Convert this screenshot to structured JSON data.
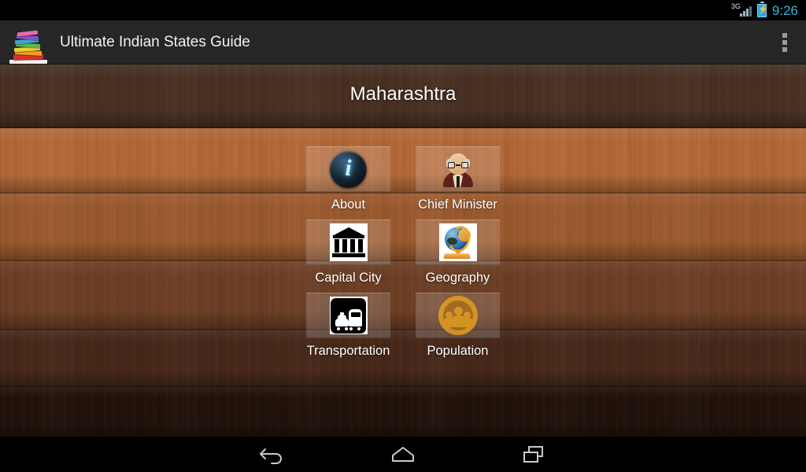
{
  "status_bar": {
    "network_label": "3G",
    "network_icon": "signal-bars-icon",
    "battery_icon": "battery-charging-icon",
    "time": "9:26",
    "time_color": "#33b5e5"
  },
  "action_bar": {
    "app_icon": "book-stack-icon",
    "title": "Ultimate Indian States Guide",
    "overflow_icon": "overflow-menu-icon",
    "background_color": "#262626"
  },
  "content": {
    "state_title": "Maharashtra",
    "background": "wood-planks",
    "menu_items": [
      {
        "label": "About",
        "icon": "info-circle-icon"
      },
      {
        "label": "Chief Minister",
        "icon": "politician-portrait-icon"
      },
      {
        "label": "Capital City",
        "icon": "classical-building-icon"
      },
      {
        "label": "Geography",
        "icon": "globe-stand-icon"
      },
      {
        "label": "Transportation",
        "icon": "taxi-bus-icon"
      },
      {
        "label": "Population",
        "icon": "people-group-icon"
      }
    ]
  },
  "nav_bar": {
    "back_label": "back-icon",
    "home_label": "home-icon",
    "recents_label": "recent-apps-icon"
  }
}
